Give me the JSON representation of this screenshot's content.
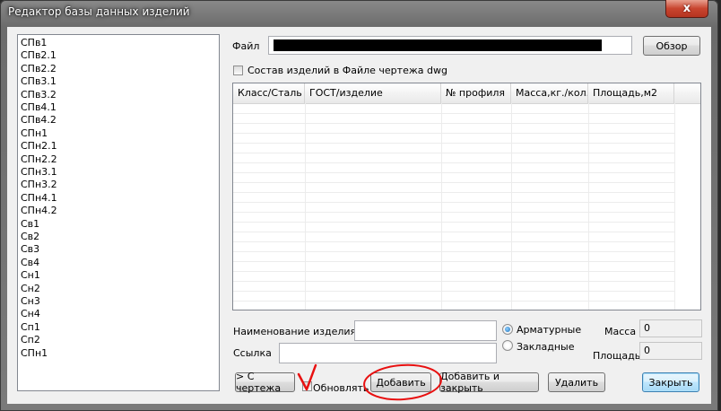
{
  "window": {
    "title": "Редактор базы данных изделий",
    "close_glyph": "x"
  },
  "products_list": [
    "СПв1",
    "СПв2.1",
    "СПв2.2",
    "СПв3.1",
    "СПв3.2",
    "СПв4.1",
    "СПв4.2",
    "СПн1",
    "СПн2.1",
    "СПн2.2",
    "СПн3.1",
    "СПн3.2",
    "СПн4.1",
    "СПн4.2",
    "Св1",
    "Св2",
    "Св3",
    "Св4",
    "Сн1",
    "Сн2",
    "Сн3",
    "Сн4",
    "Сп1",
    "Сп2",
    "СПн1"
  ],
  "file": {
    "label": "Файл",
    "value": "",
    "browse_label": "Обзор"
  },
  "composition_checkbox": {
    "label": "Состав изделий в Файле чертежа dwg",
    "checked": false
  },
  "grid": {
    "columns": [
      "Класс/Сталь",
      "ГОСТ/изделие",
      "№ профиля",
      "Масса,кг./кол.",
      "Площадь,м2"
    ],
    "rows": []
  },
  "form": {
    "name_label": "Наименование изделия",
    "name_value": "",
    "link_label": "Ссылка",
    "link_value": "",
    "type_options": [
      {
        "label": "Арматурные",
        "selected": true
      },
      {
        "label": "Закладные",
        "selected": false
      }
    ],
    "mass_label": "Масса",
    "mass_value": "0",
    "area_label": "Площадь",
    "area_value": "0"
  },
  "buttons": {
    "from_drawing": "> С чертежа",
    "update_label": "Обновлять",
    "update_checked": false,
    "add": "Добавить",
    "add_close": "Добавить и закрыть",
    "delete": "Удалить",
    "close": "Закрыть"
  },
  "annotations": {
    "mark_color": "#e81010"
  }
}
